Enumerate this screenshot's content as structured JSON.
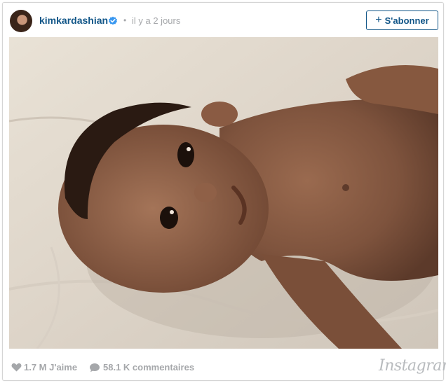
{
  "post": {
    "username": "kimkardashian",
    "separator": "•",
    "timestamp": "il y a 2 jours",
    "follow_plus": "+",
    "follow_label": "S'abonner"
  },
  "photo": {
    "subject": "baby-lying-on-blanket"
  },
  "stats": {
    "likes": "1.7 M J'aime",
    "comments": "58.1 K commentaires"
  },
  "branding": {
    "logo_text": "Instagram"
  },
  "colors": {
    "link": "#125688",
    "muted": "#a5a7aa",
    "verified": "#3897f0"
  }
}
